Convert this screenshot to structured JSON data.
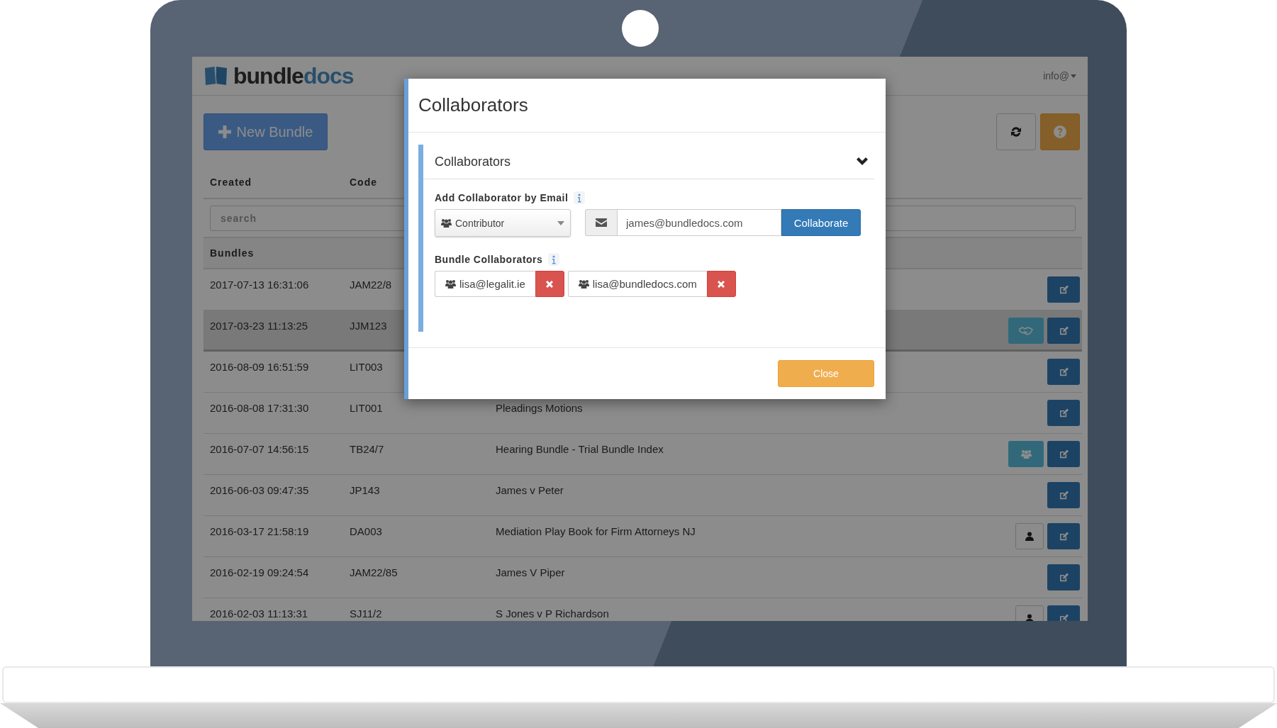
{
  "app": {
    "logo": {
      "brand": "bundle",
      "accent": "docs"
    },
    "user_menu": "info@",
    "toolbar": {
      "new_button": "New Bundle"
    },
    "table": {
      "columns": [
        "Created",
        "Code"
      ],
      "search_placeholder": "search",
      "group": "Bundles",
      "rows": [
        {
          "created": "2017-07-13 16:31:06",
          "code": "JAM22/8",
          "selected": false,
          "actions": [
            {
              "kind": "edit"
            }
          ]
        },
        {
          "created": "2017-03-23 11:13:25",
          "code": "JJM123",
          "selected": true,
          "actions": [
            {
              "kind": "collaborate"
            },
            {
              "kind": "edit"
            }
          ]
        },
        {
          "created": "2016-08-09 16:51:59",
          "code": "LIT003",
          "selected": false,
          "actions": [
            {
              "kind": "edit"
            }
          ]
        },
        {
          "created": "2016-08-08 17:31:30",
          "code": "LIT001",
          "name": "Pleadings Motions",
          "selected": false,
          "actions": [
            {
              "kind": "edit"
            }
          ]
        },
        {
          "created": "2016-07-07 14:56:15",
          "code": "TB24/7",
          "name": "Hearing Bundle - Trial Bundle Index",
          "selected": false,
          "actions": [
            {
              "kind": "group"
            },
            {
              "kind": "edit"
            }
          ]
        },
        {
          "created": "2016-06-03 09:47:35",
          "code": "JP143",
          "name": "James v Peter",
          "selected": false,
          "actions": [
            {
              "kind": "edit"
            }
          ]
        },
        {
          "created": "2016-03-17 21:58:19",
          "code": "DA003",
          "name": "Mediation Play Book for Firm Attorneys NJ",
          "selected": false,
          "actions": [
            {
              "kind": "owner"
            },
            {
              "kind": "edit"
            }
          ]
        },
        {
          "created": "2016-02-19 09:24:54",
          "code": "JAM22/85",
          "name": "James V Piper",
          "selected": false,
          "actions": [
            {
              "kind": "edit"
            }
          ]
        },
        {
          "created": "2016-02-03 11:13:31",
          "code": "SJ11/2",
          "name": "S Jones v P Richardson",
          "selected": false,
          "actions": [
            {
              "kind": "owner"
            },
            {
              "kind": "edit"
            }
          ]
        }
      ]
    }
  },
  "modal": {
    "title": "Collaborators",
    "panel": {
      "title": "Collaborators",
      "expanded": true,
      "add_label": "Add Collaborator by Email",
      "role": "Contributor",
      "email": "james@bundledocs.com",
      "submit": "Collaborate",
      "list_label": "Bundle Collaborators",
      "collaborators": [
        {
          "email": "lisa@legalit.ie"
        },
        {
          "email": "lisa@bundledocs.com"
        }
      ]
    },
    "close": "Close"
  }
}
